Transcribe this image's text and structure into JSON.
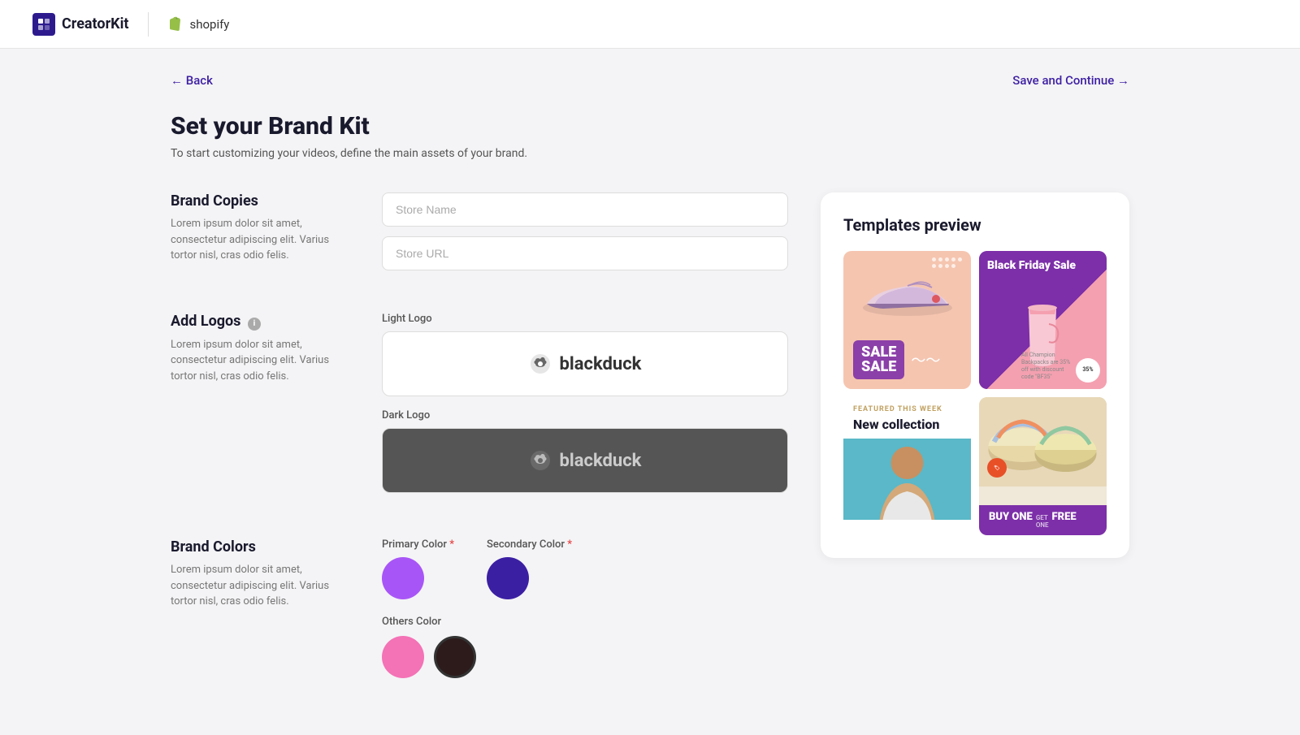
{
  "header": {
    "brand_name": "CreatorKit",
    "divider": "|",
    "shopify_label": "shopify"
  },
  "nav": {
    "back_label": "← Back",
    "save_continue_label": "Save and Continue →"
  },
  "page": {
    "title": "Set your Brand Kit",
    "subtitle": "To start customizing your videos, define the main assets of your brand."
  },
  "sections": {
    "brand_copies": {
      "title": "Brand Copies",
      "description": "Lorem ipsum dolor sit amet, consectetur adipiscing elit. Varius tortor nisl, cras odio felis.",
      "store_name_placeholder": "Store Name",
      "store_url_placeholder": "Store URL"
    },
    "add_logos": {
      "title": "Add Logos",
      "description": "Lorem ipsum dolor sit amet, consectetur adipiscing elit. Varius tortor nisl, cras odio felis.",
      "light_logo_label": "Light Logo",
      "dark_logo_label": "Dark Logo",
      "logo_text": "blackduck"
    },
    "brand_colors": {
      "title": "Brand Colors",
      "description": "Lorem ipsum dolor sit amet, consectetur adipiscing elit. Varius tortor nisl, cras odio felis.",
      "primary_label": "Primary Color",
      "secondary_label": "Secondary Color",
      "others_label": "Others Color",
      "primary_color": "#a855f7",
      "secondary_color": "#3b1fa3",
      "other_color1": "#f472b6",
      "other_color2": "#2d1b1b"
    }
  },
  "preview": {
    "title": "Templates preview",
    "templates": [
      {
        "id": "shoe-sale",
        "type": "product-sale-pink"
      },
      {
        "id": "black-friday",
        "type": "black-friday-purple",
        "label": "Black Friday Sale"
      },
      {
        "id": "new-collection",
        "type": "new-collection",
        "featured": "FEATURED THIS WEEK",
        "title": "New collection"
      },
      {
        "id": "buy-one",
        "type": "buy-one-get-one",
        "offer": "BUY ONE",
        "sub": "GET ONE FREE"
      }
    ]
  }
}
